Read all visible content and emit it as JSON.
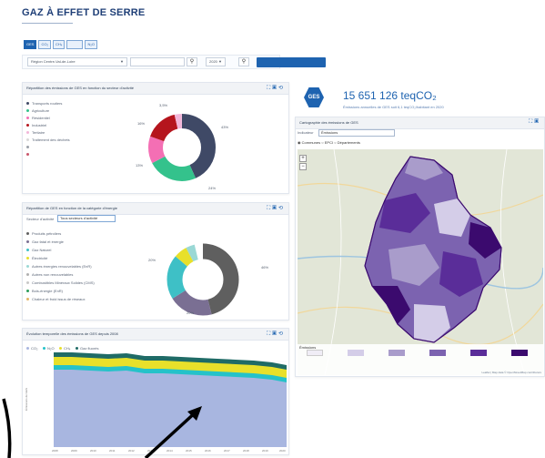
{
  "page": {
    "title": "GAZ À EFFET DE SERRE"
  },
  "gas_tabs": [
    {
      "label": "GES",
      "active": true
    },
    {
      "label": "CO₂",
      "active": false
    },
    {
      "label": "CH₄",
      "active": false
    },
    {
      "label": "",
      "active": false
    },
    {
      "label": "N₂O",
      "active": false
    }
  ],
  "filters": {
    "region": "Région Centre-Val-de-Loire",
    "domain": "",
    "year": "2020",
    "pdf_button": ""
  },
  "colors": {
    "primary": "#1e63b0",
    "donut_sector": [
      "#3f4966",
      "#34c28c",
      "#f46fb4",
      "#b5151d",
      "#f2b6d9",
      "#d9d9d9",
      "#9aa0a8"
    ],
    "donut_energy": [
      "#5f5f5f",
      "#7a6f93",
      "#3ec0c6",
      "#e8e02a",
      "#9ad8d5"
    ],
    "area_chart": {
      "CO2": "#a8b6e0",
      "N2O": "#25c2c9",
      "CH4": "#e8e02a",
      "gaz_fluores": "#1f6b66"
    },
    "map_classes": [
      "#f0edf6",
      "#d4cde8",
      "#a99ccb",
      "#7c63b0",
      "#5a2d99",
      "#3b0a6e"
    ]
  },
  "sector_panel": {
    "title": "Répartition des émissions de GES en fonction du secteur d'activité",
    "legend": [
      "Transports routiers",
      "Agriculture",
      "Résidentiel",
      "Industriel",
      "Tertiaire",
      "Traitement des déchets",
      "",
      ""
    ],
    "pct_labels": [
      "3,5%",
      "43%",
      "16%",
      "13%",
      "24%"
    ]
  },
  "energy_panel": {
    "title": "Répartition de GES en fonction de la catégorie d'énergie",
    "filter_label": "Secteur d'activité",
    "filter_value": "Tous secteurs d'activité",
    "legend": [
      "Produits pétroliers",
      "Gaz fatal et énergie",
      "Gaz Naturel",
      "Électricité",
      "Autres énergies renouvelables (EnR)",
      "Autres non renouvelables",
      "Combustibles Minéraux Solides (CMS)",
      "Bois-énergie (EnR)",
      "Chaleur et froid issus de réseaux"
    ],
    "pct_labels": [
      "20%",
      "46%",
      "20%"
    ]
  },
  "evolution_panel": {
    "title": "Évolution temporelle des émissions de GES depuis 2008",
    "legend": [
      "CO₂",
      "N₂O",
      "CH₄",
      "Gaz fluorés"
    ],
    "y_label": "Émissions de GES",
    "x_ticks": [
      "2008",
      "2009",
      "2010",
      "2011",
      "2012",
      "2013",
      "2014",
      "2015",
      "2016",
      "2017",
      "2018",
      "2019",
      "2020"
    ]
  },
  "ges_summary": {
    "badge": "GES",
    "value": "15 651 126 teqCO₂",
    "subtitle": "Émissions annuelles de GES soit 6,1 teqCO₂/habitant en 2020"
  },
  "map_panel": {
    "title": "Cartographie des émissions de GES",
    "indicator_label": "Indicateur",
    "indicator_value": "Émissions",
    "scale_options": [
      "Communes",
      "EPCI",
      "Départements"
    ],
    "legend_title": "Émissions",
    "attribution": "Leaflet | Map data © OpenStreetMap contributors"
  }
}
